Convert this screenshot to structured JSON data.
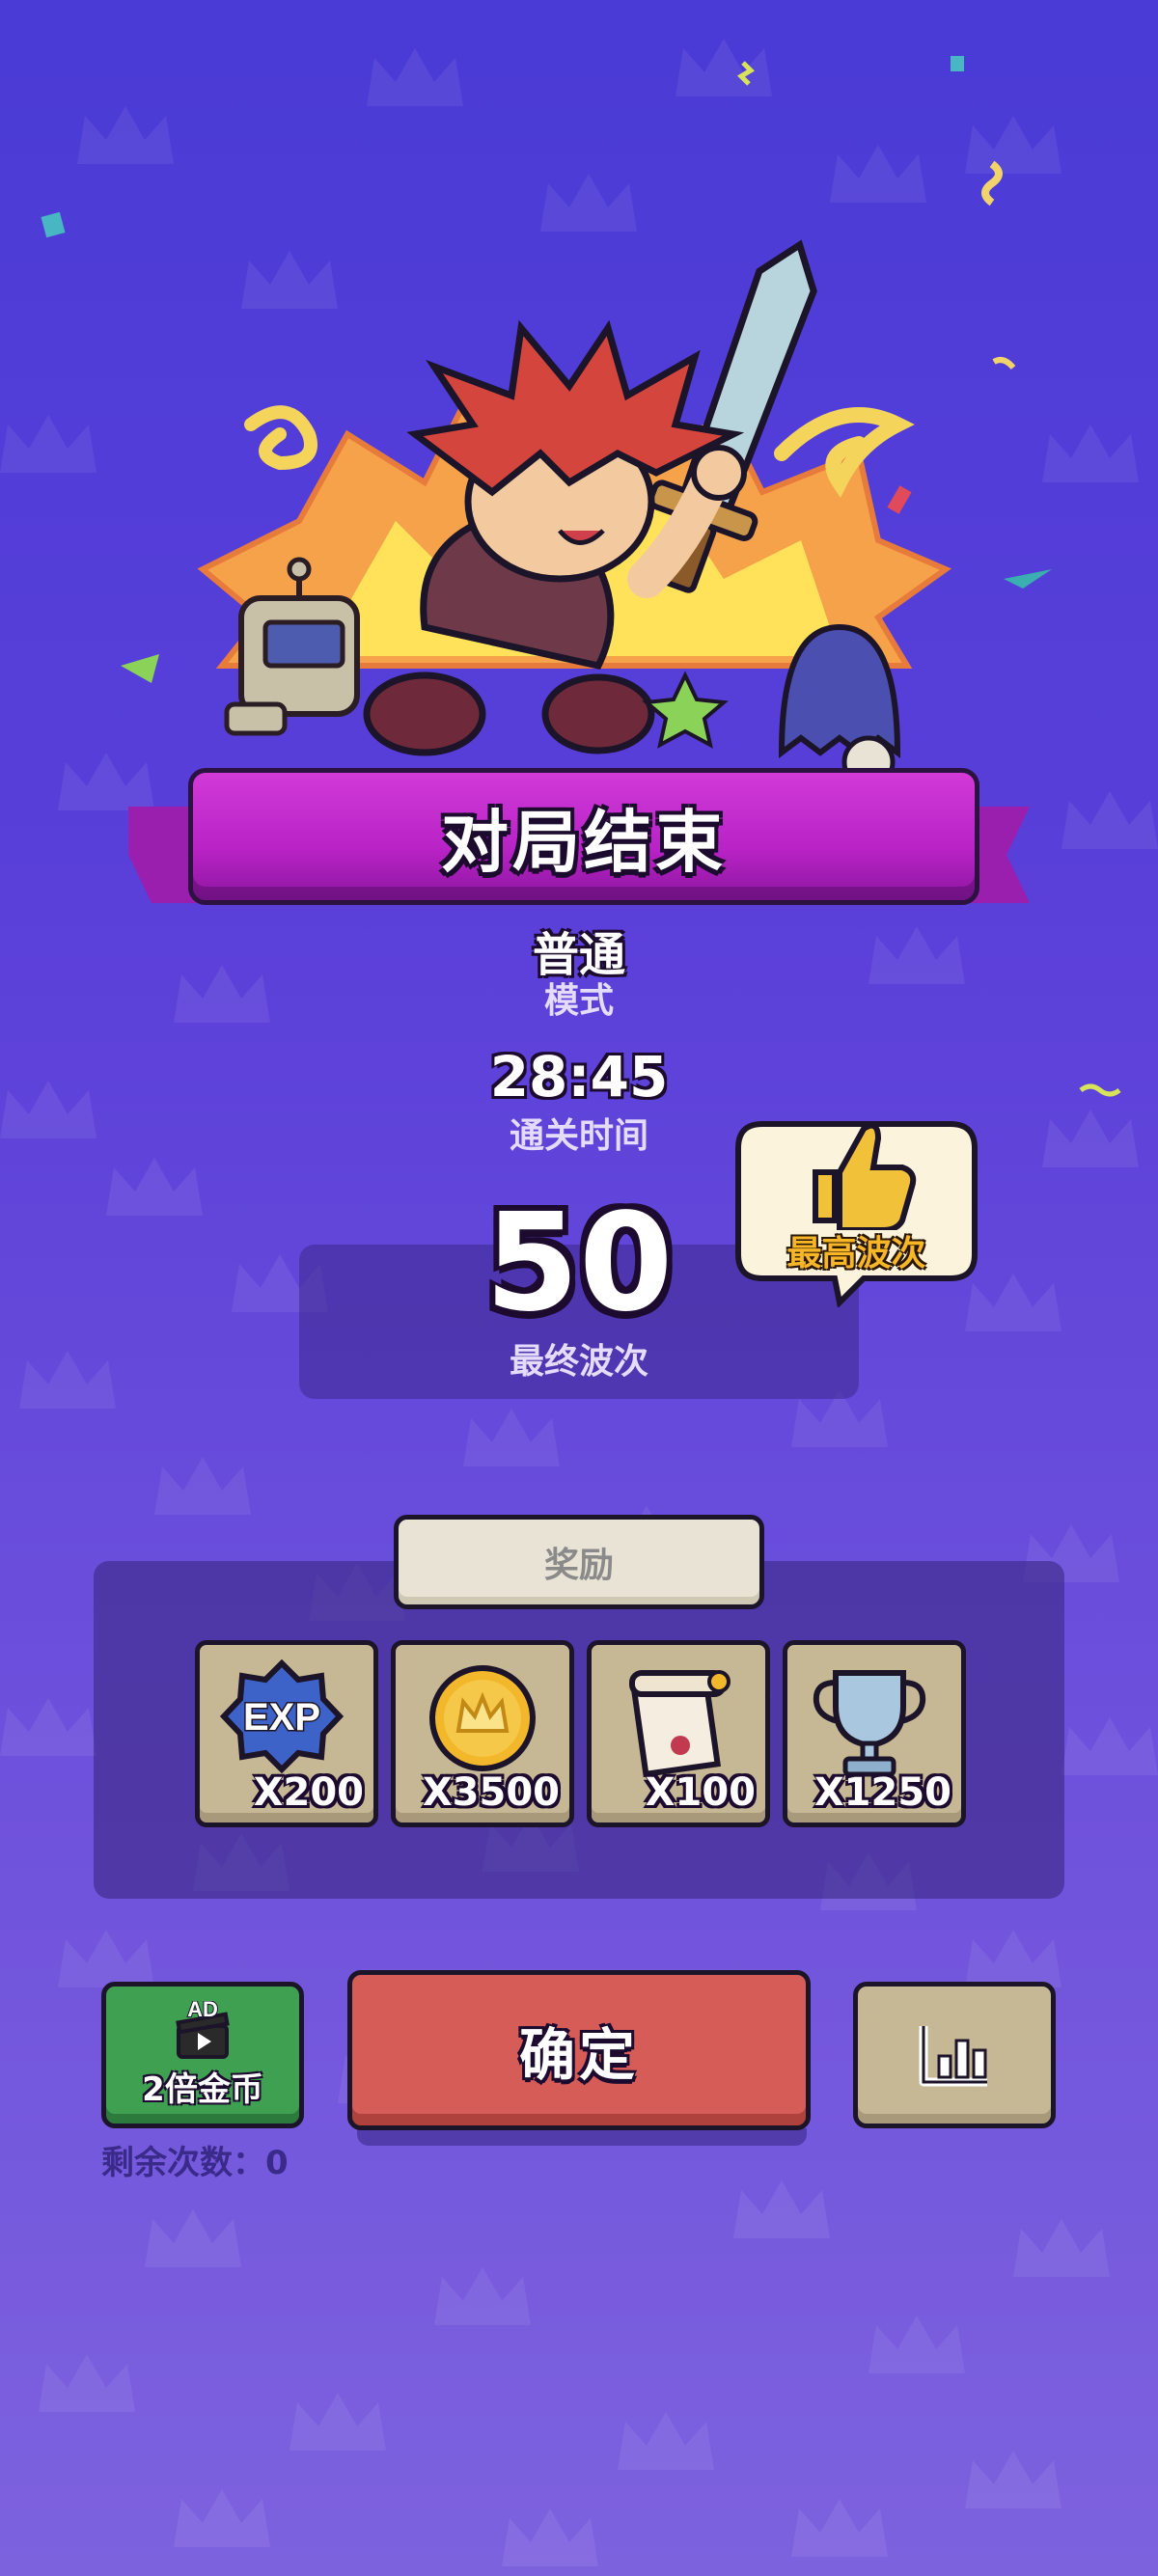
{
  "banner": {
    "title": "对局结束"
  },
  "mode": {
    "value": "普通",
    "label": "模式"
  },
  "time": {
    "value": "28:45",
    "label": "通关时间"
  },
  "wave": {
    "value": "50",
    "label": "最终波次"
  },
  "best_badge": {
    "label": "最高波次",
    "icon": "thumbs-up-icon"
  },
  "rewards": {
    "tab_label": "奖励",
    "items": [
      {
        "icon": "exp-badge-icon",
        "badge_text": "EXP",
        "amount": "X200"
      },
      {
        "icon": "gold-coin-icon",
        "amount": "X3500"
      },
      {
        "icon": "scroll-icon",
        "amount": "X100"
      },
      {
        "icon": "trophy-icon",
        "amount": "X1250"
      }
    ]
  },
  "buttons": {
    "ad": {
      "ad_tag": "AD",
      "label": "2倍金币",
      "icon": "video-ad-icon"
    },
    "confirm": {
      "label": "确定"
    },
    "stats": {
      "icon": "bar-chart-icon"
    }
  },
  "remaining": {
    "text": "剩余次数：0"
  },
  "colors": {
    "background": "#5a3fd9",
    "banner": "#b823c6",
    "confirm": "#d65c57",
    "ad_button": "#3fa052",
    "card": "#c7b895"
  }
}
